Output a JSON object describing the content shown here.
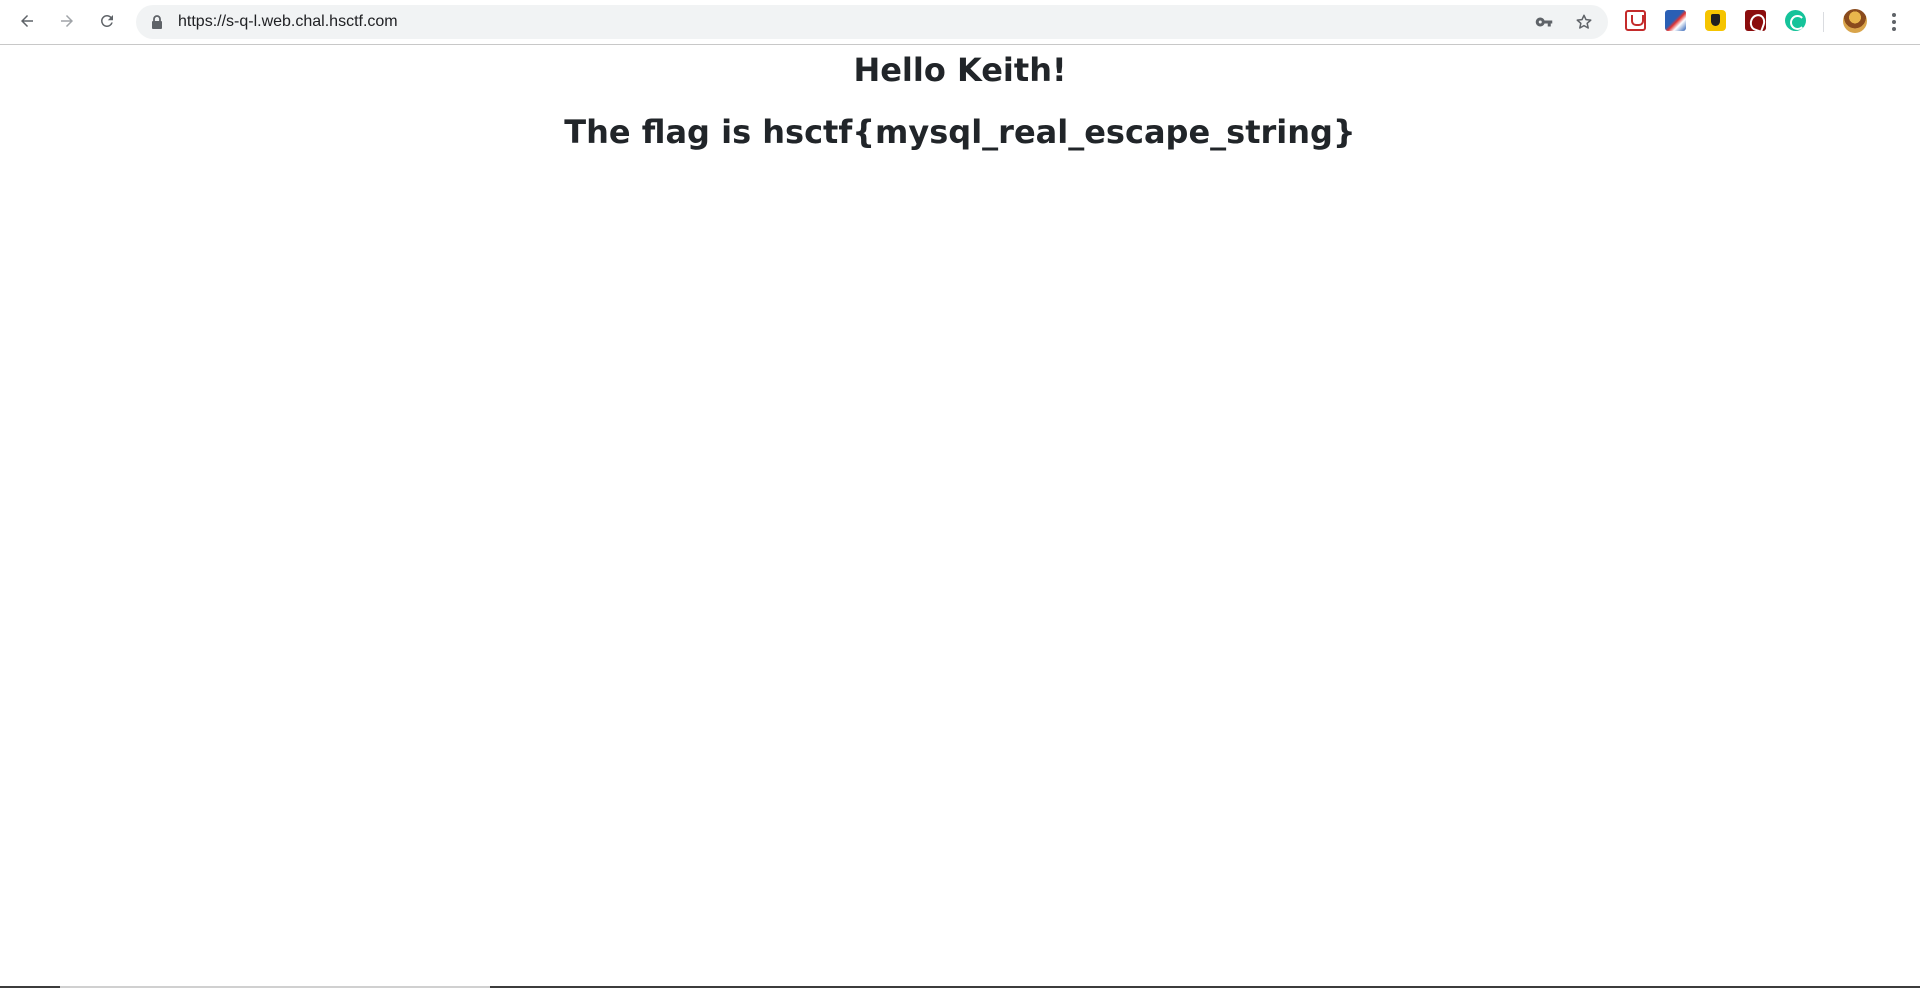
{
  "browser": {
    "url": "https://s-q-l.web.chal.hsctf.com",
    "extensions": [
      "mcafee-extension-icon",
      "flag-extension-icon",
      "shield-extension-icon",
      "acrobat-extension-icon",
      "grammarly-extension-icon"
    ]
  },
  "page": {
    "greeting": "Hello Keith!",
    "flag_message": "The flag is hsctf{mysql_real_escape_string}"
  }
}
